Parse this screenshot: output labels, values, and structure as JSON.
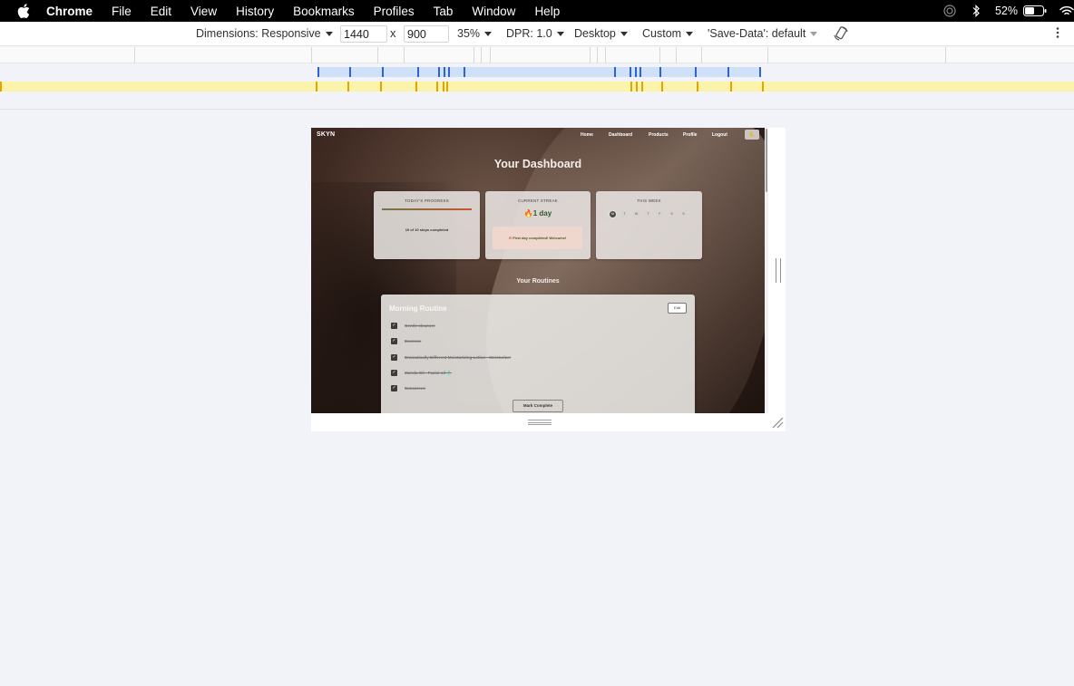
{
  "menubar": {
    "app_name": "Chrome",
    "items": [
      "File",
      "Edit",
      "View",
      "History",
      "Bookmarks",
      "Profiles",
      "Tab",
      "Window",
      "Help"
    ],
    "battery_percent": "52%"
  },
  "devtools": {
    "dimensions_label": "Dimensions: Responsive",
    "width_value": "1440",
    "times": "x",
    "height_value": "900",
    "zoom": "35%",
    "dpr": "DPR: 1.0",
    "device_type": "Desktop",
    "throttling": "Custom",
    "save_data": "'Save-Data': default"
  },
  "site": {
    "logo": "SKYN",
    "nav": [
      "Home",
      "Dashboard",
      "Products",
      "Profile",
      "Logout"
    ],
    "theme_toggle_icon": "moon-icon",
    "dashboard_title": "Your Dashboard",
    "progress": {
      "label": "TODAY'S PROGRESS",
      "text": "10 of 10 steps completed",
      "fraction": 1.0
    },
    "streak": {
      "label": "CURRENT STREAK",
      "flame": "🔥",
      "value": "1 day",
      "note_icon": "✉",
      "note": "First day completed! Welcome!"
    },
    "week": {
      "label": "THIS WEEK",
      "days": [
        "M",
        "T",
        "W",
        "T",
        "F",
        "S",
        "S"
      ],
      "active_index": 0
    },
    "routines_title": "Your Routines",
    "routine": {
      "title": "Morning Routine",
      "edit_label": "Edit",
      "steps": [
        "Gentle cleanser",
        "Essence",
        "Dramatically Different Moisturizing Lotion - Moisturizer",
        "Marula Oil - Facial oil 🧴",
        "Sunscreen"
      ],
      "complete_label": "Mark Complete"
    }
  }
}
